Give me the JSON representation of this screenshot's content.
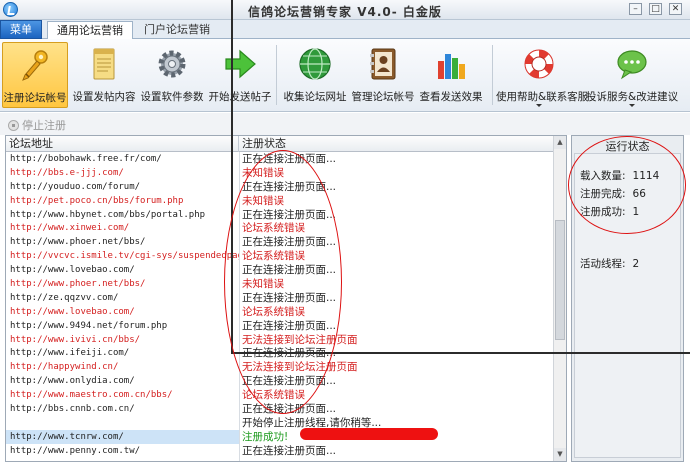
{
  "window": {
    "title": "信鸽论坛营销专家 V4.0- 白金版"
  },
  "tabs": {
    "menu": "菜单",
    "active": "通用论坛营销",
    "other": "门户论坛营销"
  },
  "ribbon": [
    {
      "id": "register-account",
      "label": "注册论坛帐号",
      "icon": "pen-key-icon"
    },
    {
      "id": "content",
      "label": "设置发帖内容",
      "icon": "notepad-icon"
    },
    {
      "id": "settings",
      "label": "设置软件参数",
      "icon": "gear-icon"
    },
    {
      "id": "send",
      "label": "开始发送帖子",
      "icon": "arrow-right-icon"
    },
    {
      "id": "collect",
      "label": "收集论坛网址",
      "icon": "globe-icon"
    },
    {
      "id": "manage",
      "label": "管理论坛帐号",
      "icon": "address-book-icon"
    },
    {
      "id": "stats",
      "label": "查看发送效果",
      "icon": "bar-chart-icon"
    },
    {
      "id": "help",
      "label": "使用帮助&联系客服",
      "icon": "lifebuoy-icon"
    },
    {
      "id": "complaint",
      "label": "投诉服务&改进建议",
      "icon": "speech-bubble-icon"
    }
  ],
  "actionbar": {
    "stop_label": "停止注册"
  },
  "grid": {
    "headers": [
      "论坛地址",
      "注册状态"
    ],
    "rows": [
      {
        "url": "http://bobohawk.free.fr/com/",
        "status": "正在连接注册页面...",
        "kind": "normal"
      },
      {
        "url": "http://bbs.e-jjj.com/",
        "status": "未知错误",
        "kind": "error"
      },
      {
        "url": "http://youduo.com/forum/",
        "status": "正在连接注册页面...",
        "kind": "normal"
      },
      {
        "url": "http://pet.poco.cn/bbs/forum.php",
        "status": "未知错误",
        "kind": "error"
      },
      {
        "url": "http://www.hbynet.com/bbs/portal.php",
        "status": "正在连接注册页面...",
        "kind": "normal"
      },
      {
        "url": "http://www.xinwei.com/",
        "status": "论坛系统错误",
        "kind": "error"
      },
      {
        "url": "http://www.phoer.net/bbs/",
        "status": "正在连接注册页面...",
        "kind": "normal"
      },
      {
        "url": "http://vvcvc.ismile.tv/cgi-sys/suspendedpage.cgi",
        "status": "论坛系统错误",
        "kind": "error"
      },
      {
        "url": "http://www.lovebao.com/",
        "status": "正在连接注册页面...",
        "kind": "normal"
      },
      {
        "url": "http://www.phoer.net/bbs/",
        "status": "未知错误",
        "kind": "error"
      },
      {
        "url": "http://ze.qqzvv.com/",
        "status": "正在连接注册页面...",
        "kind": "normal"
      },
      {
        "url": "http://www.lovebao.com/",
        "status": "论坛系统错误",
        "kind": "error"
      },
      {
        "url": "http://www.9494.net/forum.php",
        "status": "正在连接注册页面...",
        "kind": "normal"
      },
      {
        "url": "http://www.ivivi.cn/bbs/",
        "status": "无法连接到论坛注册页面",
        "kind": "error"
      },
      {
        "url": "http://www.ifeiji.com/",
        "status": "正在连接注册页面...",
        "kind": "normal"
      },
      {
        "url": "http://happywind.cn/",
        "status": "无法连接到论坛注册页面",
        "kind": "error"
      },
      {
        "url": "http://www.onlydia.com/",
        "status": "正在连接注册页面...",
        "kind": "normal"
      },
      {
        "url": "http://www.maestro.com.cn/bbs/",
        "status": "论坛系统错误",
        "kind": "error"
      },
      {
        "url": "http://bbs.cnnb.com.cn/",
        "status": "正在连接注册页面...",
        "kind": "normal"
      },
      {
        "url": "",
        "status": "开始停止注册线程,请你稍等...",
        "kind": "normal"
      },
      {
        "url": "http://www.tcnrw.com/",
        "status": "注册成功!",
        "kind": "success",
        "highlight": true
      },
      {
        "url": "http://www.penny.com.tw/",
        "status": "正在连接注册页面...",
        "kind": "normal"
      }
    ]
  },
  "status_panel": {
    "title": "运行状态",
    "loaded_label": "载入数量:",
    "loaded_value": "1114",
    "done_label": "注册完成:",
    "done_value": "66",
    "success_label": "注册成功:",
    "success_value": "1",
    "threads_label": "活动线程:",
    "threads_value": "2"
  },
  "colors": {
    "error": "#d42020",
    "success": "#1d9a1d",
    "normal": "#222222",
    "accent": "#1c64c0"
  }
}
